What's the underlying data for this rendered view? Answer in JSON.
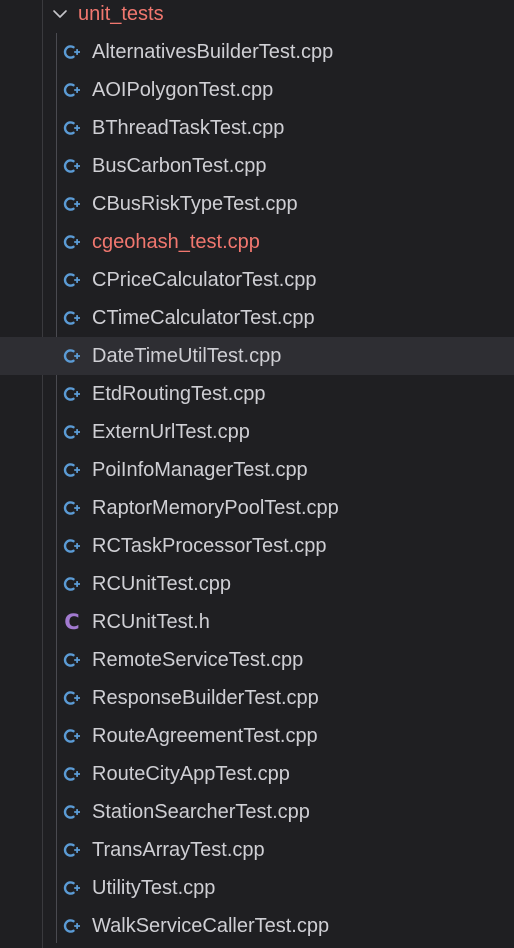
{
  "folder": {
    "name": "unit_tests",
    "expanded": true,
    "icon": "chevron-down-icon",
    "color": "#f1776f"
  },
  "colors": {
    "background": "#1f1f22",
    "selected_row": "#2e2e33",
    "file_text": "#cfcfd4",
    "modified_text": "#f1776f",
    "cpp_icon": "#5b9bd5",
    "header_icon": "#a27ad0"
  },
  "files": [
    {
      "name": "AlternativesBuilderTest.cpp",
      "type": "cpp",
      "icon": "cpp-file-icon"
    },
    {
      "name": "AOIPolygonTest.cpp",
      "type": "cpp",
      "icon": "cpp-file-icon"
    },
    {
      "name": "BThreadTaskTest.cpp",
      "type": "cpp",
      "icon": "cpp-file-icon"
    },
    {
      "name": "BusCarbonTest.cpp",
      "type": "cpp",
      "icon": "cpp-file-icon"
    },
    {
      "name": "CBusRiskTypeTest.cpp",
      "type": "cpp",
      "icon": "cpp-file-icon"
    },
    {
      "name": "cgeohash_test.cpp",
      "type": "cpp",
      "icon": "cpp-file-icon",
      "status": "modified"
    },
    {
      "name": "CPriceCalculatorTest.cpp",
      "type": "cpp",
      "icon": "cpp-file-icon"
    },
    {
      "name": "CTimeCalculatorTest.cpp",
      "type": "cpp",
      "icon": "cpp-file-icon"
    },
    {
      "name": "DateTimeUtilTest.cpp",
      "type": "cpp",
      "icon": "cpp-file-icon",
      "selected": true
    },
    {
      "name": "EtdRoutingTest.cpp",
      "type": "cpp",
      "icon": "cpp-file-icon"
    },
    {
      "name": "ExternUrlTest.cpp",
      "type": "cpp",
      "icon": "cpp-file-icon"
    },
    {
      "name": "PoiInfoManagerTest.cpp",
      "type": "cpp",
      "icon": "cpp-file-icon"
    },
    {
      "name": "RaptorMemoryPoolTest.cpp",
      "type": "cpp",
      "icon": "cpp-file-icon"
    },
    {
      "name": "RCTaskProcessorTest.cpp",
      "type": "cpp",
      "icon": "cpp-file-icon"
    },
    {
      "name": "RCUnitTest.cpp",
      "type": "cpp",
      "icon": "cpp-file-icon"
    },
    {
      "name": "RCUnitTest.h",
      "type": "h",
      "icon": "c-header-file-icon",
      "icon_text": "C"
    },
    {
      "name": "RemoteServiceTest.cpp",
      "type": "cpp",
      "icon": "cpp-file-icon"
    },
    {
      "name": "ResponseBuilderTest.cpp",
      "type": "cpp",
      "icon": "cpp-file-icon"
    },
    {
      "name": "RouteAgreementTest.cpp",
      "type": "cpp",
      "icon": "cpp-file-icon"
    },
    {
      "name": "RouteCityAppTest.cpp",
      "type": "cpp",
      "icon": "cpp-file-icon"
    },
    {
      "name": "StationSearcherTest.cpp",
      "type": "cpp",
      "icon": "cpp-file-icon"
    },
    {
      "name": "TransArrayTest.cpp",
      "type": "cpp",
      "icon": "cpp-file-icon"
    },
    {
      "name": "UtilityTest.cpp",
      "type": "cpp",
      "icon": "cpp-file-icon"
    },
    {
      "name": "WalkServiceCallerTest.cpp",
      "type": "cpp",
      "icon": "cpp-file-icon"
    }
  ]
}
